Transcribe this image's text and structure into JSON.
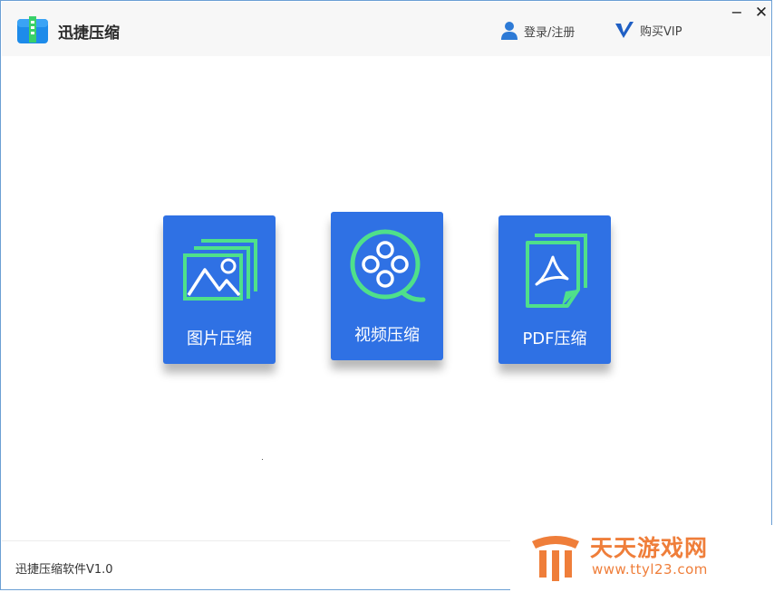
{
  "app": {
    "title": "迅捷压缩"
  },
  "header": {
    "login_label": "登录/注册",
    "vip_label": "购买VIP"
  },
  "window_controls": {
    "minimize": "−",
    "close": "✕"
  },
  "cards": [
    {
      "label": "图片压缩",
      "icon": "image-stack-icon"
    },
    {
      "label": "视频压缩",
      "icon": "film-reel-icon"
    },
    {
      "label": "PDF压缩",
      "icon": "pdf-document-icon"
    }
  ],
  "footer": {
    "version": "迅捷压缩软件V1.0"
  },
  "watermark": {
    "title": "天天游戏网",
    "url": "www.ttyl23.com"
  },
  "colors": {
    "card_blue": "#2f71e4",
    "icon_green": "#4fe08a",
    "accent_blue": "#1f6fd6",
    "watermark_orange": "#ef7e3a"
  }
}
